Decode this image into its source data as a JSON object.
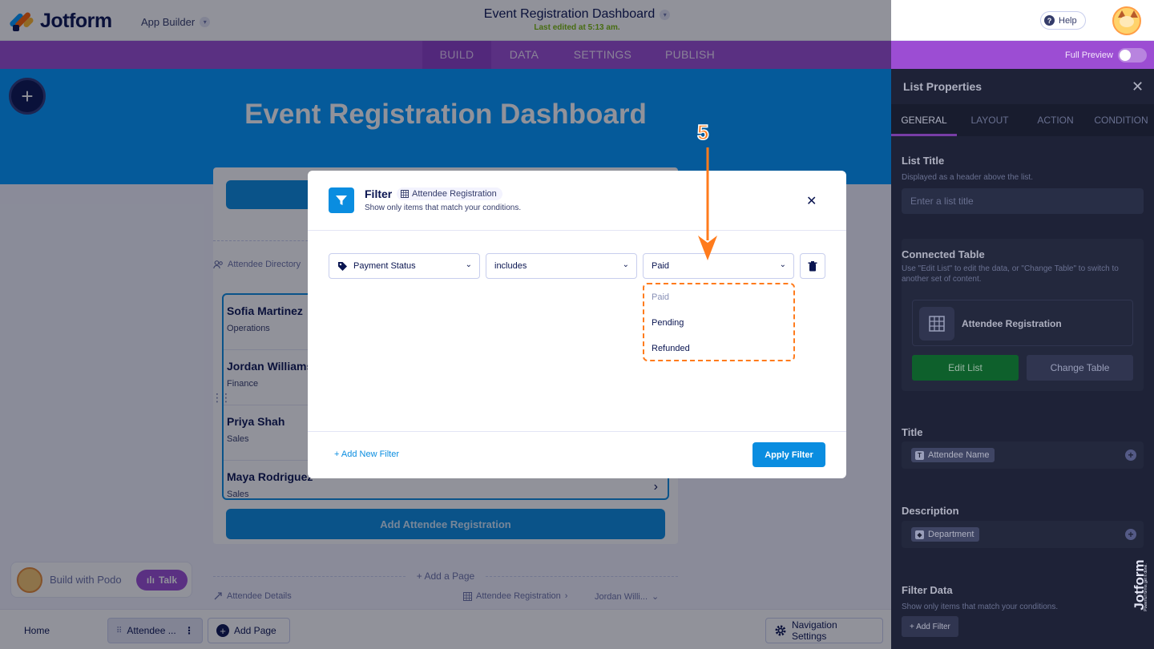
{
  "topbar": {
    "brand": "Jotform",
    "app_builder_label": "App Builder",
    "doc_title": "Event Registration Dashboard",
    "last_edited": "Last edited at 5:13 am.",
    "help_label": "Help"
  },
  "nav": {
    "tabs": [
      "BUILD",
      "DATA",
      "SETTINGS",
      "PUBLISH"
    ],
    "active_tab": "BUILD",
    "full_preview_label": "Full Preview"
  },
  "canvas": {
    "hero_title": "Event Registration Dashboard",
    "section_directory": "Attendee Directory",
    "list_items": [
      {
        "name": "Sofia Martinez",
        "department": "Operations"
      },
      {
        "name": "Jordan Williams",
        "department": "Finance"
      },
      {
        "name": "Priya Shah",
        "department": "Sales"
      },
      {
        "name": "Maya Rodriguez",
        "department": "Sales"
      }
    ],
    "add_button_label": "Add Attendee Registration",
    "add_page_label": "+ Add a Page",
    "details_label": "Attendee Details",
    "details_table": "Attendee Registration",
    "details_record": "Jordan Willi..."
  },
  "podo": {
    "label": "Build with Podo",
    "talk_label": "Talk"
  },
  "bottombar": {
    "home_label": "Home",
    "page_label": "Attendee ...",
    "add_page_label": "Add Page",
    "nav_settings_label": "Navigation Settings"
  },
  "right_panel": {
    "title": "List Properties",
    "tabs": [
      "GENERAL",
      "LAYOUT",
      "ACTION",
      "CONDITION"
    ],
    "active_tab": "GENERAL",
    "list_title_label": "List Title",
    "list_title_help": "Displayed as a header above the list.",
    "list_title_placeholder": "Enter a list title",
    "connected_table_label": "Connected Table",
    "connected_table_help": "Use \"Edit List\" to edit the data, or \"Change Table\" to switch to another set of content.",
    "table_name": "Attendee Registration",
    "edit_list_label": "Edit List",
    "change_table_label": "Change Table",
    "title_label": "Title",
    "title_field": "Attendee Name",
    "description_label": "Description",
    "description_field": "Department",
    "filter_data_label": "Filter Data",
    "filter_data_help": "Show only items that match your conditions.",
    "add_filter_label": "+ Add Filter",
    "brand_vertical": "Jotform",
    "brand_tagline": "Powerful forms get it done."
  },
  "filter_modal": {
    "title": "Filter",
    "table_tag": "Attendee Registration",
    "subtitle": "Show only items that match your conditions.",
    "field_select": "Payment Status",
    "operator_select": "includes",
    "value_select": "Paid",
    "options": [
      "Paid",
      "Pending",
      "Refunded"
    ],
    "add_new_filter_label": "+ Add New Filter",
    "apply_label": "Apply Filter"
  },
  "annotation": {
    "step": "5"
  },
  "colors": {
    "brand_purple": "#9c4dd3",
    "primary_blue": "#0a8de0",
    "annotation_orange": "#ff7b1c",
    "panel_dark": "#24293f"
  }
}
